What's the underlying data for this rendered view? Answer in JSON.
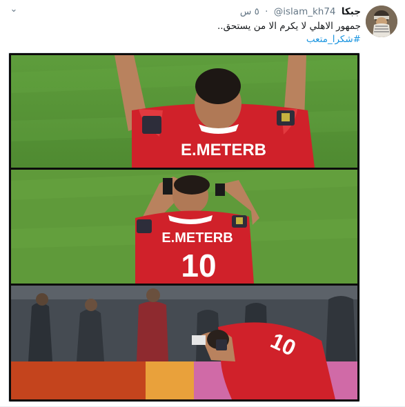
{
  "tweet": {
    "author_name": "جبكا",
    "handle": "@islam_kh74",
    "separator": "·",
    "timestamp": "٥ س",
    "text": "جمهور الاهلي لا يكرم الا من يستحق..",
    "hashtag": "#شكرا_متعب",
    "menu_icon": "chevron-down-icon"
  },
  "media": {
    "panels": [
      {
        "jersey_name": "E.METERB",
        "shirt_number": ""
      },
      {
        "jersey_name": "E.METERB",
        "shirt_number": "10"
      },
      {
        "jersey_name": "",
        "shirt_number": "10"
      }
    ]
  },
  "colors": {
    "link": "#1b95e0",
    "muted": "#657786",
    "text": "#14171a",
    "jersey_red": "#d0212a",
    "pitch_green": "#5f9a3a"
  }
}
